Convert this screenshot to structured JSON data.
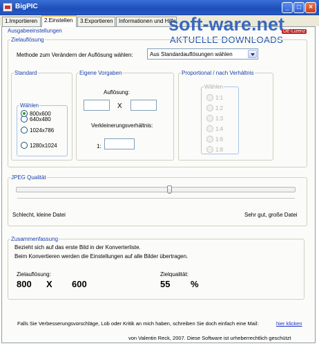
{
  "window": {
    "title": "BigPIC",
    "controls": [
      "_",
      "□",
      "×"
    ]
  },
  "tabs": [
    {
      "label": "1.Importieren"
    },
    {
      "label": "2.Einstellen"
    },
    {
      "label": "3.Exportieren"
    },
    {
      "label": "Informationen und Hilfe"
    }
  ],
  "watermark": {
    "top": "soft-ware.net",
    "bottom": "AKTUELLE DOWNLOADS",
    "badge": "DE-Lizenz"
  },
  "settings": {
    "group_label": "Ausgabeeinstellungen",
    "target": {
      "legend": "Zielauflösung",
      "method_label": "Methode zum Verändern der Auflösung wählen:",
      "method_value": "Aus Standardauflösungen wählen"
    },
    "standard": {
      "legend": "Standard",
      "inner_legend": "Wählen",
      "options": [
        "640x480",
        "800x600",
        "1024x786",
        "1280x1024"
      ],
      "selected": "800x600"
    },
    "custom": {
      "legend": "Eigene Vorgaben",
      "resolution_label": "Auflösung:",
      "times": "X",
      "width_value": "",
      "height_value": "",
      "ratio_label": "Verkleinerungsverhältnis:",
      "ratio_prefix": "1:",
      "ratio_value": ""
    },
    "proportional": {
      "legend": "Proportional / nach Verhältnis",
      "inner_legend": "Wählen",
      "options": [
        "1:1",
        "1:2",
        "1:3",
        "1:4",
        "1:6",
        "1:8"
      ]
    }
  },
  "jpeg": {
    "legend": "JPEG Qualität",
    "min_label": "Schlecht, kleine Datei",
    "max_label": "Sehr gut, große Datei",
    "quality_fraction": 0.55
  },
  "summary": {
    "legend": "Zusammenfassung",
    "line1": "Bezieht sich auf das erste Bild in der Konverterliste.",
    "line2": "Beim Konvertieren werden die Einstellungen auf alle Bilder übertragen.",
    "res_label": "Zielauflösung:",
    "res_w": "800",
    "res_x": "X",
    "res_h": "600",
    "quality_label": "Zielqualität:",
    "quality_value": "55",
    "quality_unit": "%"
  },
  "footer": {
    "text": "Falls Sie Verbesserungsvorschläge, Lob oder Kritik an mich haben, schreiben Sie doch einfach eine Mail:",
    "link": "hier klicken",
    "copyright": "von Valentin Reck, 2007. Diese Software ist urheberrechtlich geschützt"
  }
}
